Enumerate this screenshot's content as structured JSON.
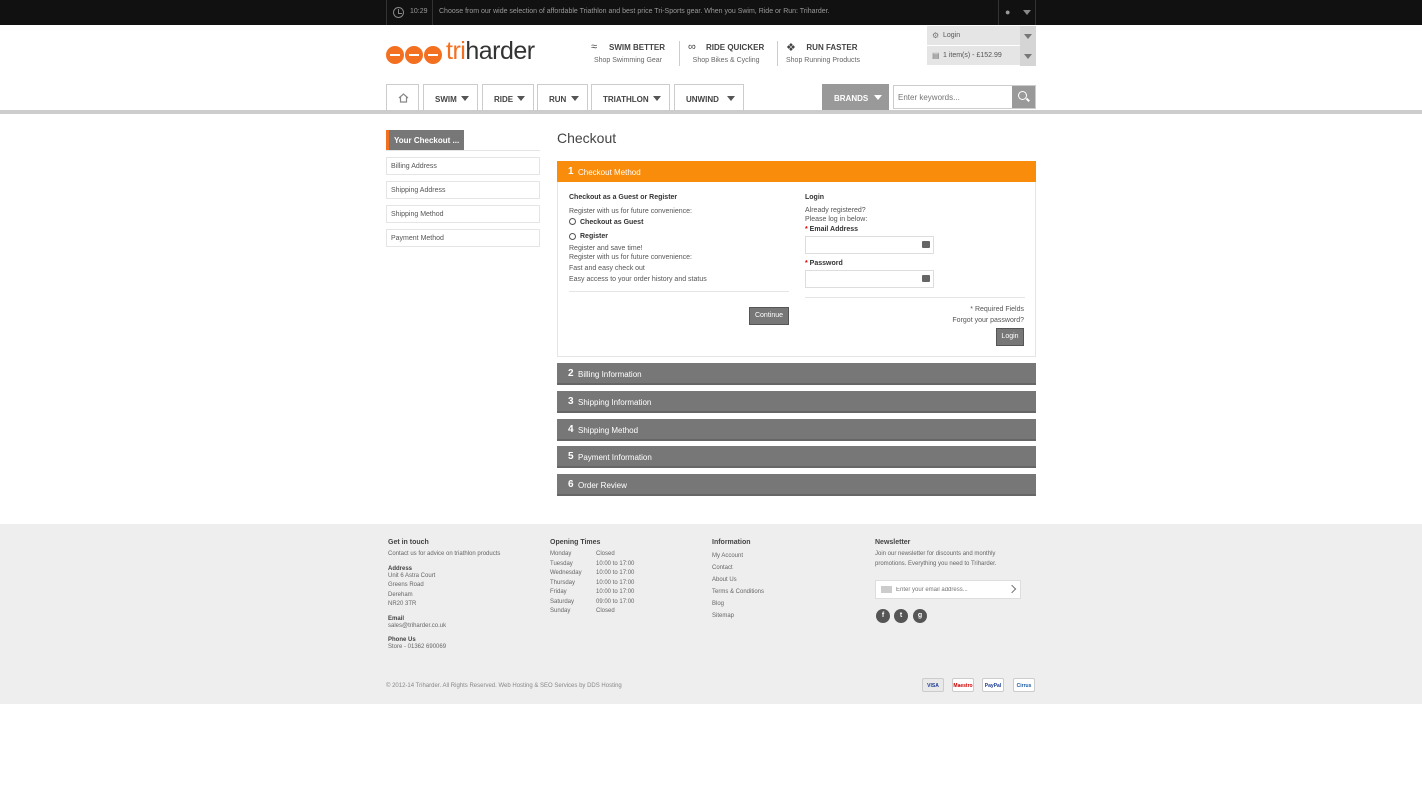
{
  "topbar": {
    "time": "10:29",
    "message": "Choose from our wide selection of affordable Triathlon and best price Tri-Sports gear. When you Swim, Ride or Run: Triharder."
  },
  "logo": {
    "prefix": "tri",
    "suffix": "harder"
  },
  "usps": [
    {
      "title": "SWIM BETTER",
      "sub": "Shop Swimming Gear"
    },
    {
      "title": "RIDE QUICKER",
      "sub": "Shop Bikes & Cycling"
    },
    {
      "title": "RUN FASTER",
      "sub": "Shop Running Products"
    }
  ],
  "account": {
    "login": "Login",
    "cart": "1 item(s) - £152.99"
  },
  "nav": {
    "items": [
      "SWIM",
      "RIDE",
      "RUN",
      "TRIATHLON",
      "UNWIND"
    ],
    "brands": "BRANDS",
    "search_placeholder": "Enter keywords..."
  },
  "sidebar": {
    "title": "Your Checkout ...",
    "links": [
      "Billing Address",
      "Shipping Address",
      "Shipping Method",
      "Payment Method"
    ]
  },
  "checkout": {
    "title": "Checkout",
    "step1": {
      "num": "1",
      "label": "Checkout Method"
    },
    "guest": {
      "heading": "Checkout as a Guest or Register",
      "intro": "Register with us for future convenience:",
      "opt_guest": "Checkout as Guest",
      "opt_register": "Register",
      "save_time": "Register and save time!",
      "convenience": "Register with us for future convenience:",
      "fast": "Fast and easy check out",
      "access": "Easy access to your order history and status",
      "continue": "Continue"
    },
    "login": {
      "heading": "Login",
      "already": "Already registered?",
      "please": "Please log in below:",
      "email_label": "Email Address",
      "password_label": "Password",
      "required": "* Required Fields",
      "forgot": "Forgot your password?",
      "button": "Login"
    },
    "steps": [
      {
        "num": "2",
        "label": "Billing Information"
      },
      {
        "num": "3",
        "label": "Shipping Information"
      },
      {
        "num": "4",
        "label": "Shipping Method"
      },
      {
        "num": "5",
        "label": "Payment Information"
      },
      {
        "num": "6",
        "label": "Order Review"
      }
    ]
  },
  "footer": {
    "touch": {
      "heading": "Get in touch",
      "advice": "Contact us for advice on triathlon products",
      "address_h": "Address",
      "address": [
        "Unit 6 Astra Court",
        "Greens Road",
        "Dereham",
        "NR20 3TR"
      ],
      "email_h": "Email",
      "email": "sales@triharder.co.uk",
      "phone_h": "Phone Us",
      "phone": "Store - 01362 690069"
    },
    "opening": {
      "heading": "Opening Times",
      "days": [
        [
          "Monday",
          "Closed"
        ],
        [
          "Tuesday",
          "10:00 to 17:00"
        ],
        [
          "Wednesday",
          "10:00 to 17:00"
        ],
        [
          "Thursday",
          "10:00 to 17:00"
        ],
        [
          "Friday",
          "10:00 to 17:00"
        ],
        [
          "Saturday",
          "09:00 to 17:00"
        ],
        [
          "Sunday",
          "Closed"
        ]
      ]
    },
    "info": {
      "heading": "Information",
      "links": [
        "My Account",
        "Contact",
        "About Us",
        "Terms & Conditions",
        "Blog",
        "Sitemap"
      ]
    },
    "newsletter": {
      "heading": "Newsletter",
      "text1": "Join our newsletter for discounts and monthly",
      "text2": "promotions. Everything you need to Triharder.",
      "placeholder": "Enter your email address..."
    },
    "copyright": "© 2012-14 Triharder. All Rights Reserved. Web Hosting & SEO Services by DDS Hosting",
    "cards": [
      "VISA",
      "Maestro",
      "PayPal",
      "Cirrus"
    ]
  }
}
